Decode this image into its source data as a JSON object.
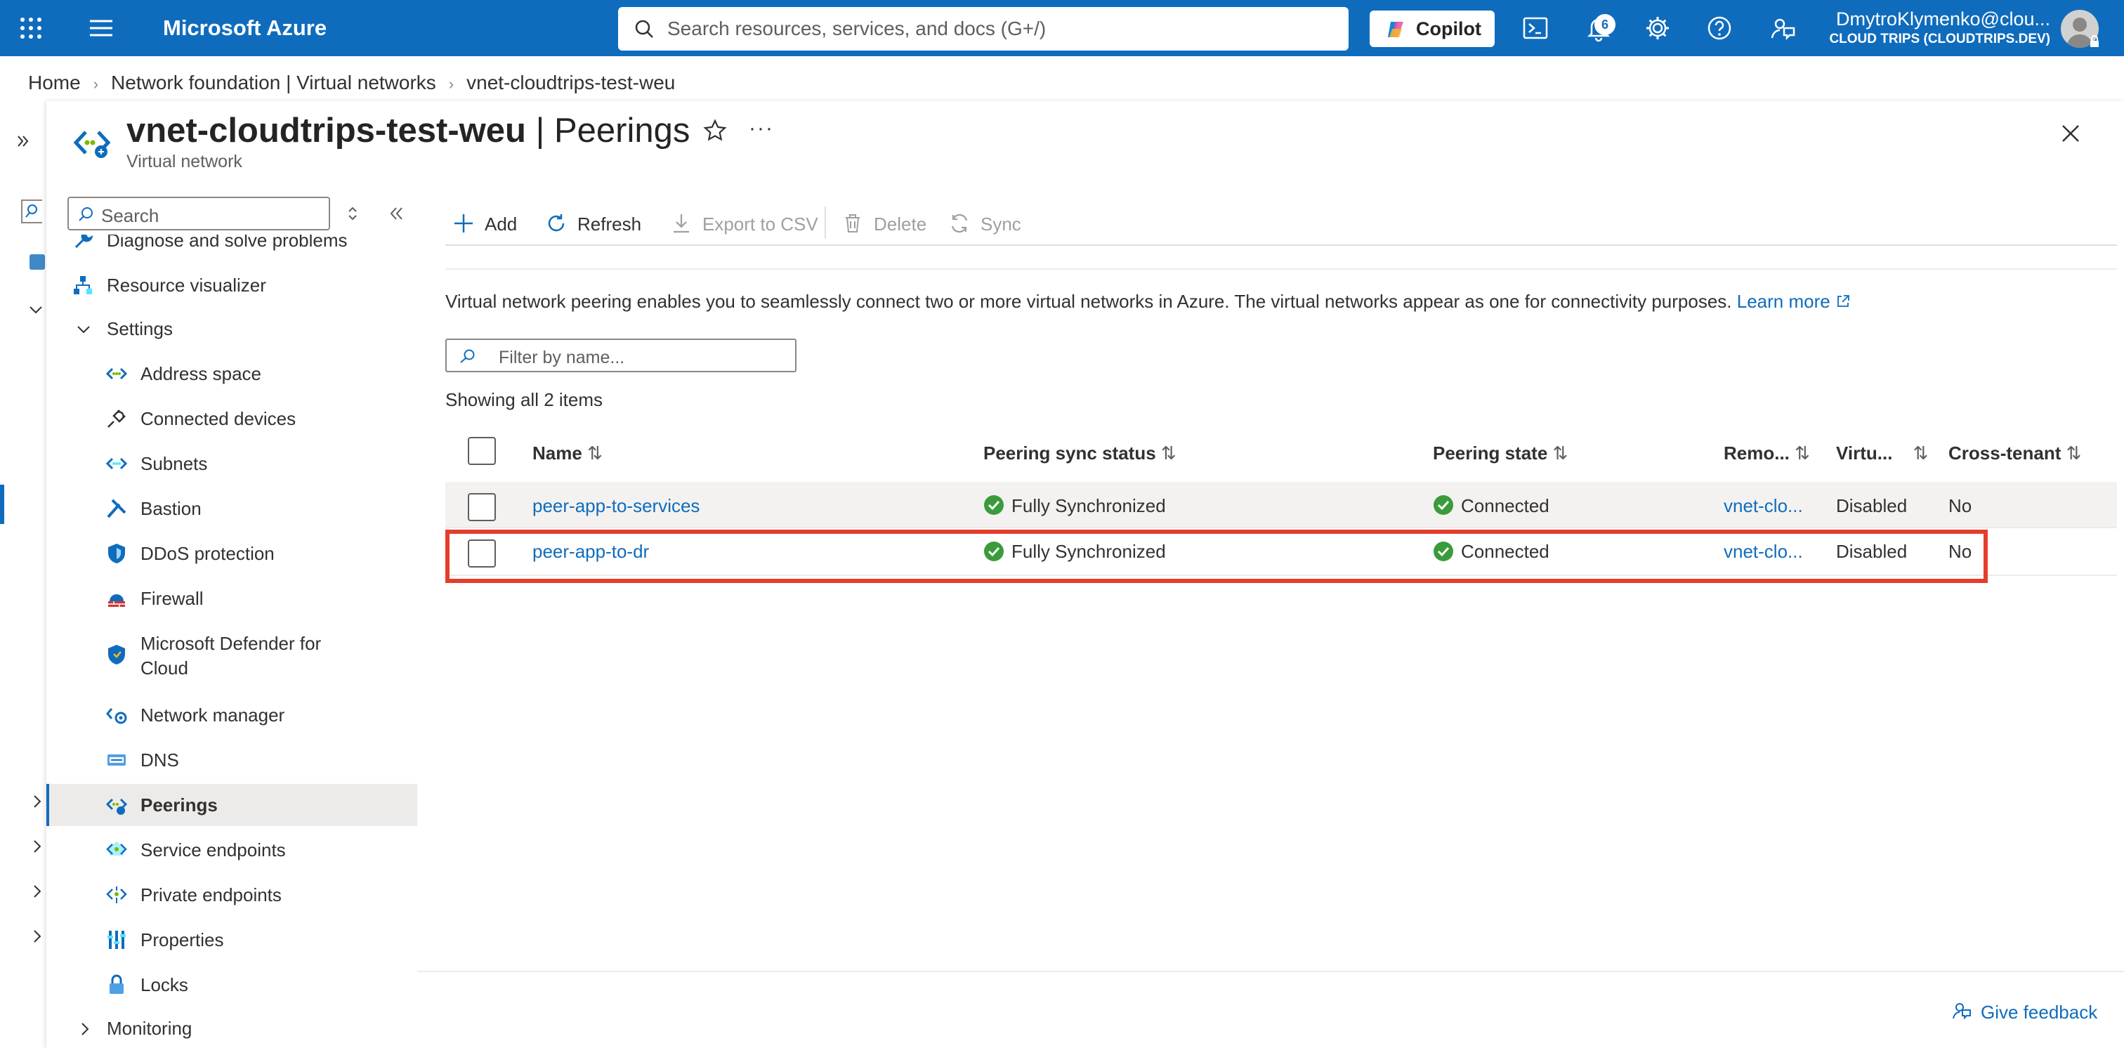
{
  "topbar": {
    "title": "Microsoft Azure",
    "search_placeholder": "Search resources, services, and docs (G+/)",
    "copilot_label": "Copilot",
    "notification_count": "6",
    "user_name": "DmytroKlymenko@clou...",
    "tenant": "CLOUD TRIPS (CLOUDTRIPS.DEV)"
  },
  "breadcrumb": [
    "Home",
    "Network foundation | Virtual networks",
    "vnet-cloudtrips-test-weu"
  ],
  "blade": {
    "resource_name": "vnet-cloudtrips-test-weu",
    "section": "| Peerings",
    "subtitle": "Virtual network",
    "more": "···"
  },
  "menu": {
    "search_placeholder": "Search",
    "items": [
      {
        "label": "Diagnose and solve problems",
        "icon": "wrench-icon"
      },
      {
        "label": "Resource visualizer",
        "icon": "hierarchy-icon"
      },
      {
        "label": "Settings",
        "icon": "chevron-down-icon"
      },
      {
        "label": "Address space",
        "icon": "vnet-icon"
      },
      {
        "label": "Connected devices",
        "icon": "plug-icon"
      },
      {
        "label": "Subnets",
        "icon": "subnet-icon"
      },
      {
        "label": "Bastion",
        "icon": "bastion-icon"
      },
      {
        "label": "DDoS protection",
        "icon": "shield-icon"
      },
      {
        "label": "Firewall",
        "icon": "firewall-icon"
      },
      {
        "label": "Microsoft Defender for",
        "label2": "Cloud",
        "icon": "defender-icon"
      },
      {
        "label": "Network manager",
        "icon": "network-manager-icon"
      },
      {
        "label": "DNS",
        "icon": "dns-icon"
      },
      {
        "label": "Peerings",
        "icon": "peerings-icon"
      },
      {
        "label": "Service endpoints",
        "icon": "service-endpoint-icon"
      },
      {
        "label": "Private endpoints",
        "icon": "private-endpoint-icon"
      },
      {
        "label": "Properties",
        "icon": "properties-icon"
      },
      {
        "label": "Locks",
        "icon": "lock-icon"
      },
      {
        "label": "Monitoring",
        "icon": "chevron-right-icon"
      }
    ]
  },
  "toolbar": {
    "add": "Add",
    "refresh": "Refresh",
    "export": "Export to CSV",
    "delete": "Delete",
    "sync": "Sync"
  },
  "content": {
    "info_text": "Virtual network peering enables you to seamlessly connect two or more virtual networks in Azure. The virtual networks appear as one for connectivity purposes.",
    "learn_more": "Learn more",
    "filter_placeholder": "Filter by name...",
    "showing": "Showing all 2 items"
  },
  "table": {
    "headers": [
      "Name",
      "Peering sync status",
      "Peering state",
      "Remo...",
      "Virtu...",
      "Cross-tenant"
    ],
    "rows": [
      {
        "name": "peer-app-to-services",
        "sync": "Fully Synchronized",
        "state": "Connected",
        "remote": "vnet-clo...",
        "virtual": "Disabled",
        "cross": "No"
      },
      {
        "name": "peer-app-to-dr",
        "sync": "Fully Synchronized",
        "state": "Connected",
        "remote": "vnet-clo...",
        "virtual": "Disabled",
        "cross": "No"
      }
    ]
  },
  "footer": {
    "feedback": "Give feedback"
  },
  "colors": {
    "accent": "#0f6cbd",
    "highlight": "#e53d2b",
    "success": "#3a9b3a"
  }
}
